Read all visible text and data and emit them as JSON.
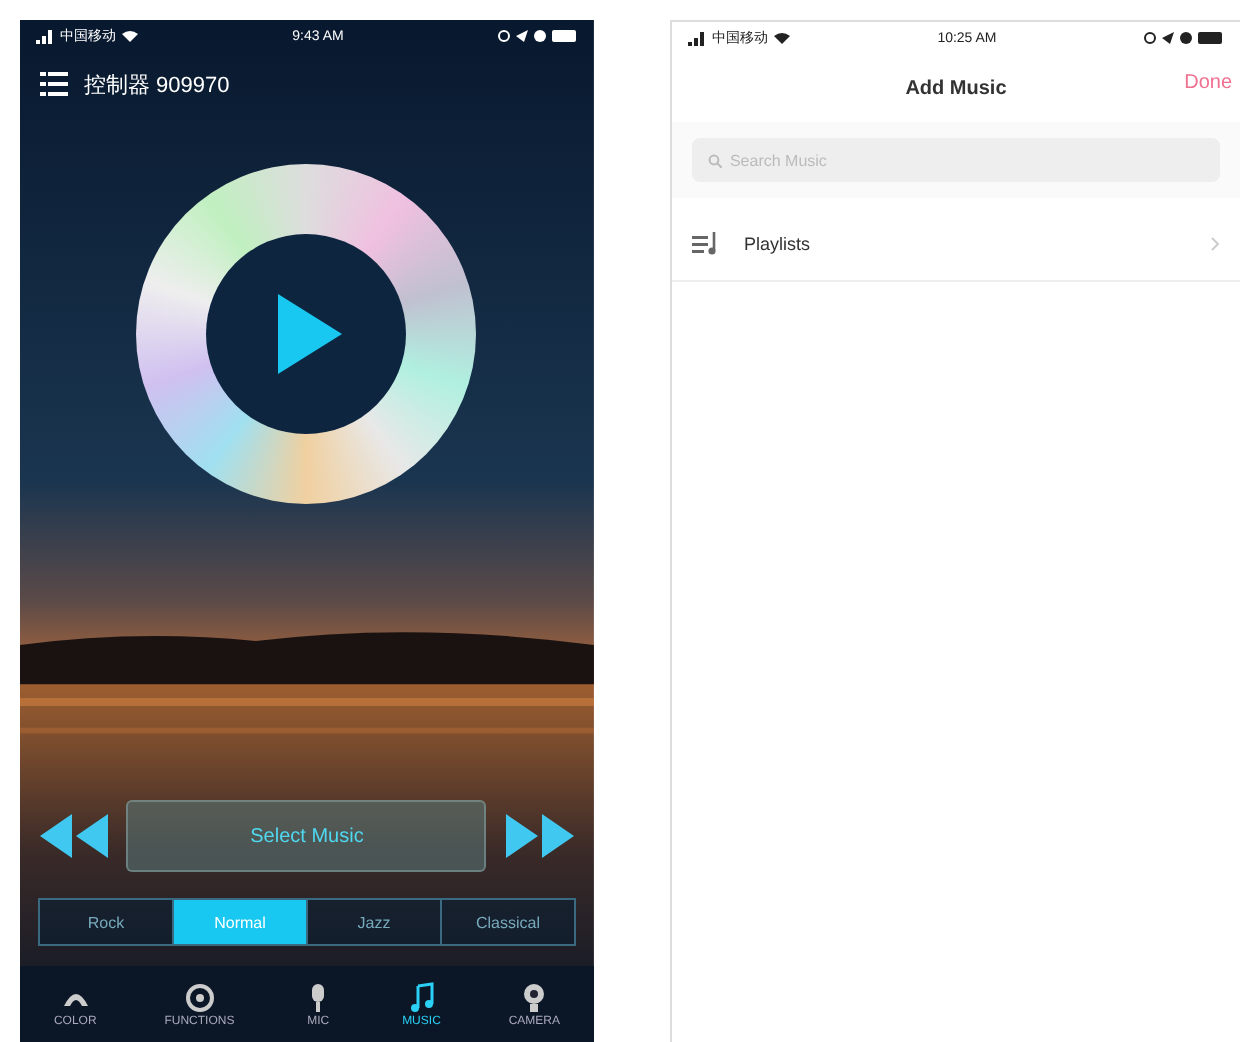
{
  "player": {
    "status_bar": {
      "carrier": "中国移动",
      "time": "9:43 AM"
    },
    "title": "控制器 909970",
    "select_button": "Select Music",
    "modes": [
      {
        "label": "Rock",
        "selected": false
      },
      {
        "label": "Normal",
        "selected": true
      },
      {
        "label": "Jazz",
        "selected": false
      },
      {
        "label": "Classical",
        "selected": false
      }
    ],
    "nav": [
      {
        "label": "COLOR",
        "selected": false
      },
      {
        "label": "FUNCTIONS",
        "selected": false
      },
      {
        "label": "MIC",
        "selected": false
      },
      {
        "label": "MUSIC",
        "selected": true
      },
      {
        "label": "CAMERA",
        "selected": false
      }
    ]
  },
  "add_music": {
    "status_bar": {
      "carrier": "中国移动",
      "time": "10:25 AM"
    },
    "title": "Add Music",
    "done": "Done",
    "search": {
      "placeholder": "Search Music"
    },
    "rows": [
      {
        "label": "Playlists"
      }
    ]
  }
}
